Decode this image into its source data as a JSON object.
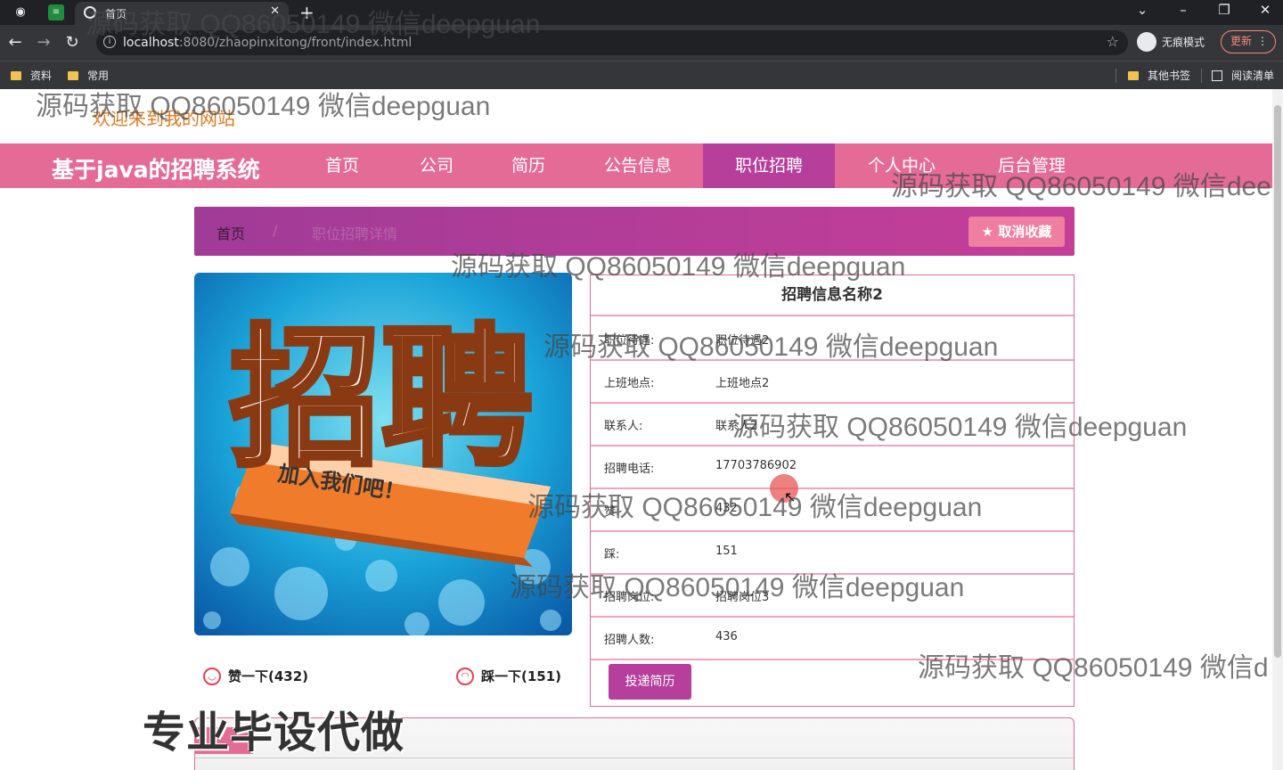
{
  "browser": {
    "tab_title": "首页",
    "new_tab_glyph": "+",
    "url_host": "localhost",
    "url_rest": ":8080/zhaopinxitong/front/index.html",
    "incognito_label": "无痕模式",
    "update_label": "更新",
    "bookmarks": [
      "资料",
      "常用"
    ],
    "bookmarks_right": [
      "其他书签",
      "阅读清单"
    ]
  },
  "page": {
    "welcome": "欢迎来到我的网站",
    "brand": "基于java的招聘系统",
    "nav": [
      "首页",
      "公司",
      "简历",
      "公告信息",
      "职位招聘",
      "个人中心",
      "后台管理"
    ],
    "active_nav": "职位招聘",
    "breadcrumb": [
      "首页",
      "/",
      "职位招聘详情"
    ],
    "unfavorite_label": "取消收藏",
    "poster": {
      "big_text": "招聘",
      "slogan": "加入我们吧！"
    },
    "like_label": "赞一下(432)",
    "dislike_label": "踩一下(151)",
    "detail": {
      "title": "招聘信息名称2",
      "rows": [
        {
          "k": "职位待遇:",
          "v": "职位待遇2"
        },
        {
          "k": "上班地点:",
          "v": "上班地点2"
        },
        {
          "k": "联系人:",
          "v": "联系人2"
        },
        {
          "k": "招聘电话:",
          "v": "17703786902"
        },
        {
          "k": "赞:",
          "v": "432"
        },
        {
          "k": "踩:",
          "v": "151"
        },
        {
          "k": "招聘岗位:",
          "v": "招聘岗位3"
        },
        {
          "k": "招聘人数:",
          "v": "436"
        }
      ],
      "apply_label": "投递简历"
    },
    "promo_text": "专业毕设代做"
  },
  "watermark_text": "源码获取 QQ86050149 微信deepguan",
  "watermark_cut_1": "源码获取 QQ86050149 微信dee",
  "watermark_cut_2": "源码获取 QQ86050149 微信d",
  "colors": {
    "nav_bg": "#e56b97",
    "nav_active": "#b63f9b",
    "accent": "#b63f9b",
    "welcome": "#e07b22"
  }
}
